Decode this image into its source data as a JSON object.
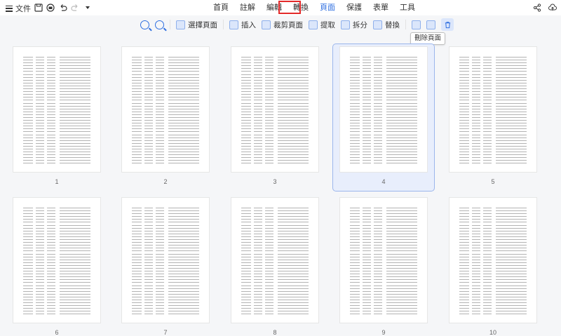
{
  "menubar": {
    "file_label": "文件",
    "tabs": [
      {
        "label": "首頁",
        "active": false
      },
      {
        "label": "註解",
        "active": false
      },
      {
        "label": "編輯",
        "active": false
      },
      {
        "label": "轉換",
        "active": false
      },
      {
        "label": "頁面",
        "active": true
      },
      {
        "label": "保護",
        "active": false
      },
      {
        "label": "表單",
        "active": false
      },
      {
        "label": "工具",
        "active": false
      }
    ],
    "quick_access_icons": [
      "save-icon",
      "print-icon",
      "undo-icon",
      "redo-icon",
      "dropdown-icon"
    ],
    "right_icons": [
      "share-icon",
      "cloud-upload-icon"
    ]
  },
  "toolbar": {
    "zoom_out_icon": "zoom-out-icon",
    "zoom_in_icon": "zoom-in-icon",
    "select_pages": "選擇頁面",
    "insert": "插入",
    "crop_pages": "裁剪頁面",
    "extract": "提取",
    "split": "拆分",
    "replace": "替換",
    "delete_tooltip": "刪除頁面"
  },
  "pages": [
    "1",
    "2",
    "3",
    "4",
    "5",
    "6",
    "7",
    "8",
    "9",
    "10"
  ],
  "selected_page": "4",
  "colors": {
    "accent": "#2f6fe0",
    "highlight_box": "#e32a2a",
    "selection_fill": "#e8eefc"
  }
}
